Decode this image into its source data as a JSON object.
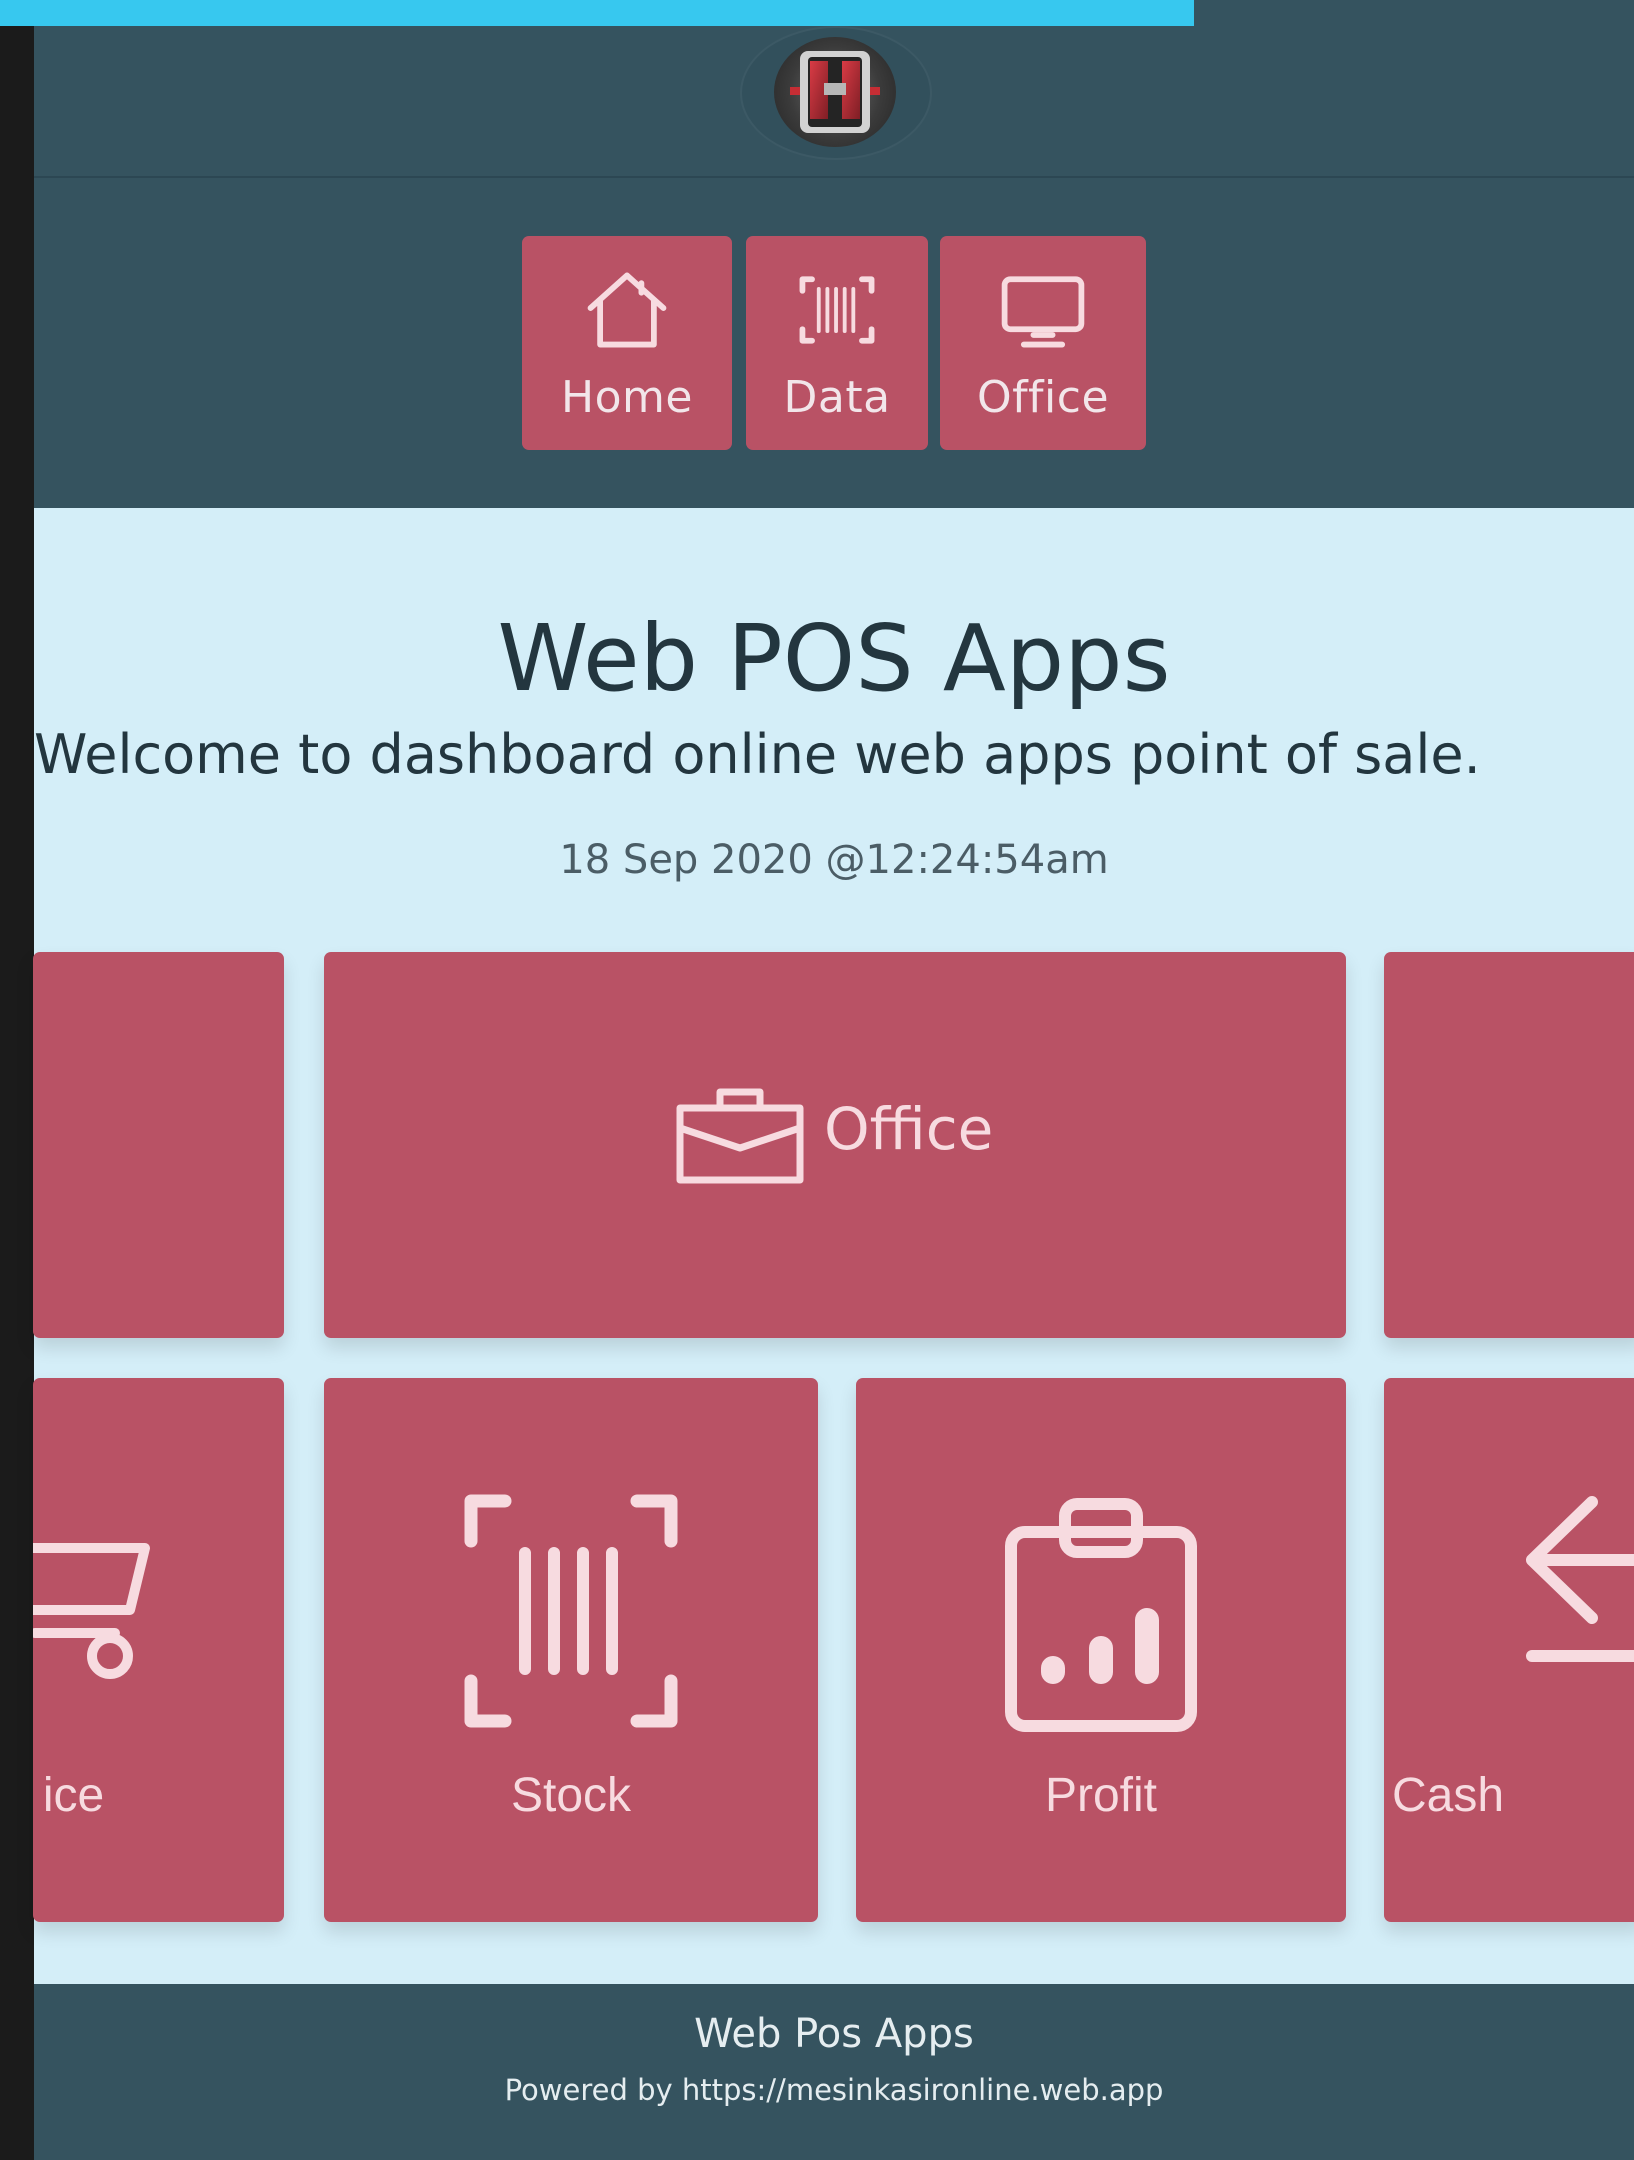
{
  "brand": {
    "logo_text": "H"
  },
  "top_nav": {
    "items": [
      {
        "label": "Home",
        "icon": "home-icon"
      },
      {
        "label": "Data",
        "icon": "barcode-icon"
      },
      {
        "label": "Office",
        "icon": "monitor-icon"
      }
    ]
  },
  "hero": {
    "title": "Web POS Apps",
    "subtitle": "Welcome to dashboard online web apps point of sale.",
    "datetime": "18 Sep 2020 @12:24:54am"
  },
  "tiles": {
    "row1": [
      {
        "label": "",
        "icon": ""
      },
      {
        "label": "Office",
        "icon": "briefcase-icon"
      },
      {
        "label": "",
        "icon": ""
      }
    ],
    "row2": [
      {
        "label": "ice",
        "icon": "cart-icon"
      },
      {
        "label": "Stock",
        "icon": "barcode-icon"
      },
      {
        "label": "Profit",
        "icon": "clipboard-chart-icon"
      },
      {
        "label": "Cash",
        "icon": "cash-icon"
      }
    ]
  },
  "footer": {
    "title": "Web Pos Apps",
    "powered": "Powered by https://mesinkasironline.web.app"
  },
  "colors": {
    "accent_cyan": "#37c8ef",
    "panel_dark": "#35535f",
    "tile_red": "#b95265",
    "hero_bg": "#d4eef8"
  }
}
